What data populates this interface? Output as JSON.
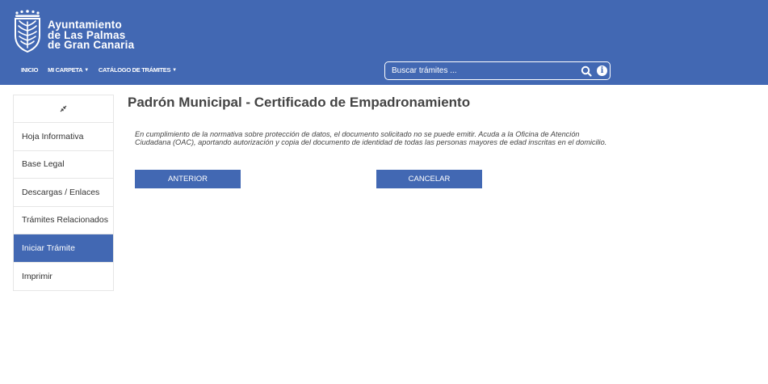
{
  "header": {
    "org_name": [
      "Ayuntamiento",
      "de  Las  Palmas",
      "de Gran Canaria"
    ],
    "nav": [
      {
        "label": "INICIO",
        "dropdown": false
      },
      {
        "label": "MI CARPETA",
        "dropdown": true
      },
      {
        "label": "CATÁLOGO DE TRÁMITES",
        "dropdown": true
      }
    ],
    "search": {
      "placeholder": "Buscar trámites ..."
    }
  },
  "sidebar": {
    "toggle_icon": "collapse-arrows-icon",
    "items": [
      {
        "label": "Hoja Informativa",
        "active": false
      },
      {
        "label": "Base Legal",
        "active": false
      },
      {
        "label": "Descargas / Enlaces",
        "active": false
      },
      {
        "label": "Trámites Relacionados",
        "active": false
      },
      {
        "label": "Iniciar Trámite",
        "active": true
      },
      {
        "label": "Imprimir",
        "active": false
      }
    ]
  },
  "main": {
    "title": "Padrón Municipal - Certificado de Empadronamiento",
    "notice": "En cumplimiento de la normativa sobre protección de datos, el documento solicitado no se puede emitir. Acuda a la Oficina de Atención Ciudadana (OAC), aportando autorización y copia del documento de identidad de todas las personas mayores de edad inscritas en el domicilio.",
    "buttons": {
      "previous": "ANTERIOR",
      "cancel": "CANCELAR"
    }
  },
  "colors": {
    "brand": "#4268b3",
    "text": "#444444",
    "border": "#e6e6e6"
  }
}
